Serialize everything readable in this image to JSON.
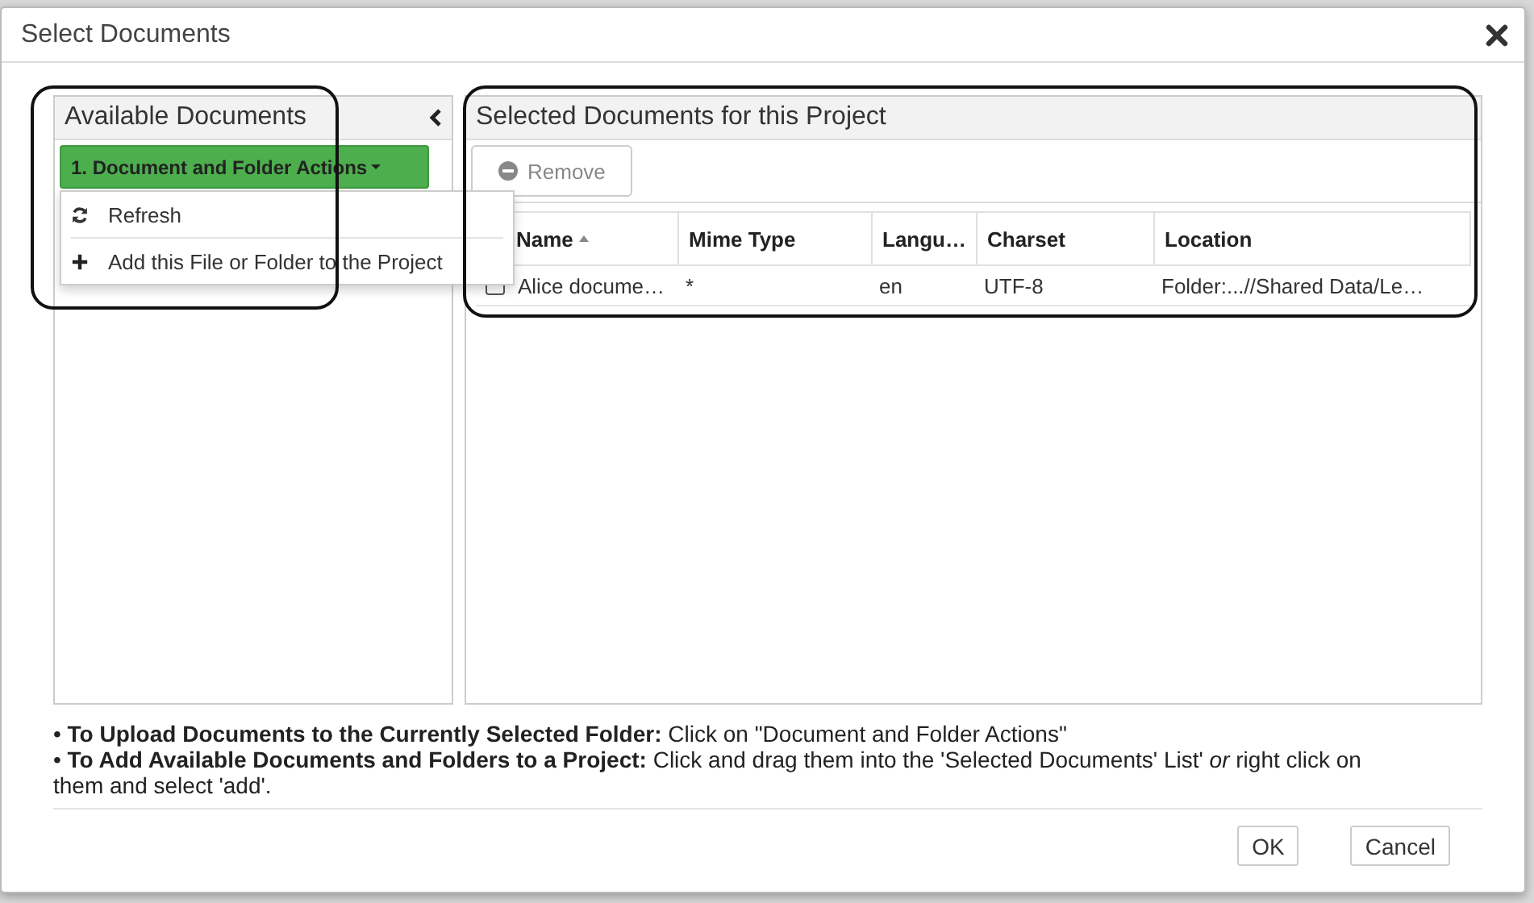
{
  "dialog": {
    "title": "Select Documents"
  },
  "available_panel": {
    "title": "Available Documents",
    "actions_button": "1. Document and Folder Actions",
    "menu": [
      {
        "kind": "refresh",
        "label": "Refresh"
      },
      {
        "kind": "add",
        "label": "Add this File or Folder to the Project"
      }
    ]
  },
  "selected_panel": {
    "title": "Selected Documents for this Project",
    "remove_button": {
      "label": "Remove",
      "disabled": true
    },
    "table": {
      "columns": [
        {
          "label": "Name",
          "sorted": true
        },
        {
          "label": "Mime Type",
          "sorted": false
        },
        {
          "label": "Langu…",
          "sorted": false
        },
        {
          "label": "Charset",
          "sorted": false
        },
        {
          "label": "Location",
          "sorted": false
        }
      ],
      "rows": [
        {
          "checked": false,
          "cells": [
            "Alice docume…",
            "*",
            "en",
            "UTF-8",
            "Folder:...//Shared Data/Le…"
          ]
        }
      ]
    }
  },
  "help": [
    "• **To Upload Documents to the Currently Selected Folder:** Click on \"Document and Folder Actions\"",
    "• **To Add Available Documents and Folders to a Project:** Click and drag them into the 'Selected Documents' List' *or* right click on them and select 'add'."
  ],
  "buttons": [
    "OK",
    "Cancel"
  ]
}
